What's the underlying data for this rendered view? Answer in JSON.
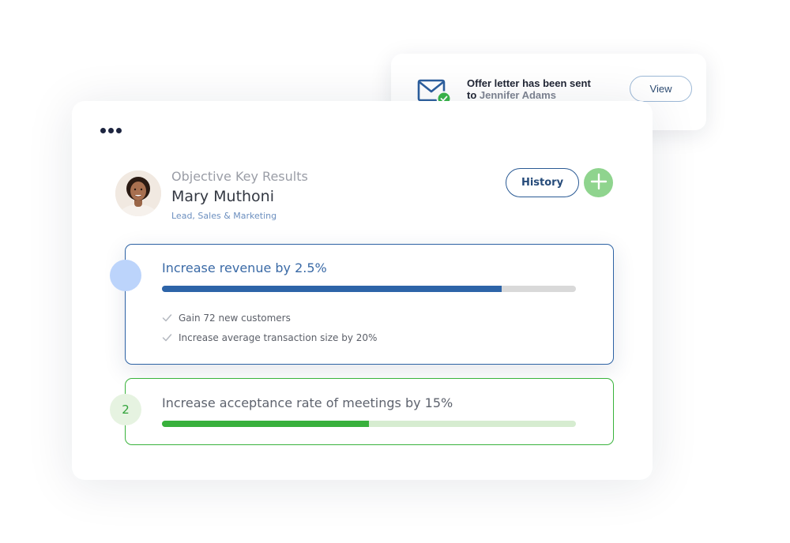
{
  "notification": {
    "line1": "Offer letter has been sent",
    "line2_prefix": "to",
    "recipient": "Jennifer Adams",
    "view_label": "View",
    "icon": "mail-check-icon"
  },
  "profile": {
    "section_label": "Objective Key Results",
    "name": "Mary Muthoni",
    "role": "Lead, Sales & Marketing"
  },
  "actions": {
    "history_label": "History",
    "add_icon": "plus-icon"
  },
  "goals": [
    {
      "marker": "",
      "title": "Increase revenue by 2.5%",
      "progress": 0.82,
      "key_results": [
        "Gain 72 new customers",
        "Increase average transaction size by 20%"
      ]
    },
    {
      "marker": "2",
      "title": "Increase acceptance rate of meetings by 15%",
      "progress": 0.5
    }
  ],
  "colors": {
    "primary_blue": "#2d64a8",
    "success_green": "#38b03c",
    "add_button_green": "#8fd48e"
  }
}
